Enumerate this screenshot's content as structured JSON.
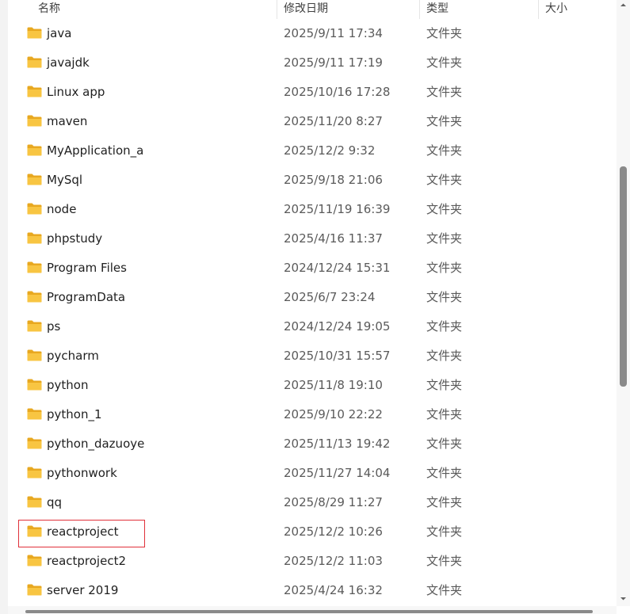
{
  "header": {
    "name": "名称",
    "date": "修改日期",
    "type": "类型",
    "size": "大小"
  },
  "rows": [
    {
      "name": "java",
      "date": "2025/9/11 17:34",
      "type": "文件夹"
    },
    {
      "name": "javajdk",
      "date": "2025/9/11 17:19",
      "type": "文件夹"
    },
    {
      "name": "Linux app",
      "date": "2025/10/16 17:28",
      "type": "文件夹"
    },
    {
      "name": "maven",
      "date": "2025/11/20 8:27",
      "type": "文件夹"
    },
    {
      "name": "MyApplication_a",
      "date": "2025/12/2 9:32",
      "type": "文件夹"
    },
    {
      "name": "MySql",
      "date": "2025/9/18 21:06",
      "type": "文件夹"
    },
    {
      "name": "node",
      "date": "2025/11/19 16:39",
      "type": "文件夹"
    },
    {
      "name": "phpstudy",
      "date": "2025/4/16 11:37",
      "type": "文件夹"
    },
    {
      "name": "Program Files",
      "date": "2024/12/24 15:31",
      "type": "文件夹"
    },
    {
      "name": "ProgramData",
      "date": "2025/6/7 23:24",
      "type": "文件夹"
    },
    {
      "name": "ps",
      "date": "2024/12/24 19:05",
      "type": "文件夹"
    },
    {
      "name": "pycharm",
      "date": "2025/10/31 15:57",
      "type": "文件夹"
    },
    {
      "name": "python",
      "date": "2025/11/8 19:10",
      "type": "文件夹"
    },
    {
      "name": "python_1",
      "date": "2025/9/10 22:22",
      "type": "文件夹"
    },
    {
      "name": "python_dazuoye",
      "date": "2025/11/13 19:42",
      "type": "文件夹"
    },
    {
      "name": "pythonwork",
      "date": "2025/11/27 14:04",
      "type": "文件夹"
    },
    {
      "name": "qq",
      "date": "2025/8/29 11:27",
      "type": "文件夹"
    },
    {
      "name": "reactproject",
      "date": "2025/12/2 10:26",
      "type": "文件夹"
    },
    {
      "name": "reactproject2",
      "date": "2025/12/2 11:03",
      "type": "文件夹"
    },
    {
      "name": "server 2019",
      "date": "2025/4/24 16:32",
      "type": "文件夹"
    }
  ],
  "highlighted_item": "reactproject",
  "colors": {
    "folder": "#f8c542",
    "folder_dark": "#e8a820",
    "highlight_border": "#e0303a"
  },
  "icons": {
    "folder": "folder-icon",
    "scroll_up": "chevron-up-icon",
    "scroll_down": "chevron-down-icon"
  }
}
